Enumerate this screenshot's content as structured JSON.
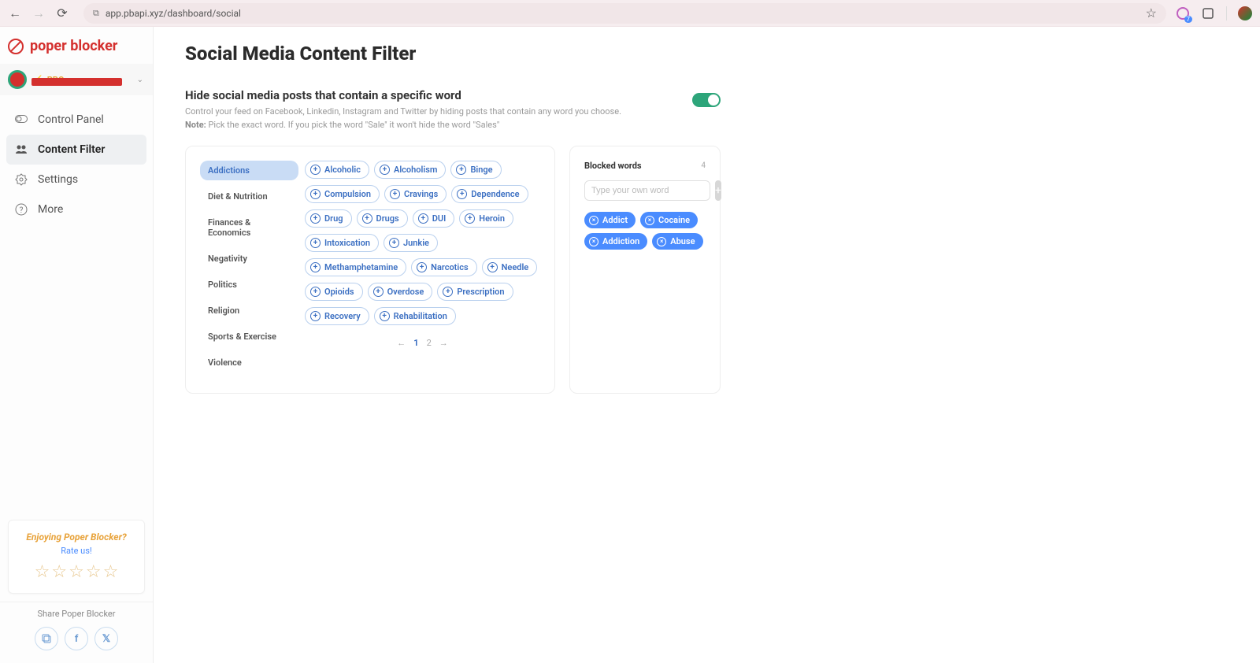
{
  "browser": {
    "url": "app.pbapi.xyz/dashboard/social",
    "ext_badge": "7"
  },
  "brand": {
    "name": "poper blocker"
  },
  "account": {
    "badge": "PRO"
  },
  "sidebar": {
    "items": [
      {
        "label": "Control Panel"
      },
      {
        "label": "Content Filter"
      },
      {
        "label": "Settings"
      },
      {
        "label": "More"
      }
    ]
  },
  "rate": {
    "title": "Enjoying Poper Blocker?",
    "link": "Rate us!"
  },
  "share": {
    "label": "Share Poper Blocker"
  },
  "page": {
    "title": "Social Media Content Filter"
  },
  "hero": {
    "title": "Hide social media posts that contain a specific word",
    "sub": "Control your feed on Facebook, Linkedin, Instagram and Twitter by hiding posts that contain any word you choose.",
    "note_label": "Note:",
    "note_text": "Pick the exact word. If you pick the word \"Sale\" it won't hide the word \"Sales\""
  },
  "categories": [
    "Addictions",
    "Diet & Nutrition",
    "Finances & Economics",
    "Negativity",
    "Politics",
    "Religion",
    "Sports & Exercise",
    "Violence"
  ],
  "suggested_words": [
    "Alcoholic",
    "Alcoholism",
    "Binge",
    "Compulsion",
    "Cravings",
    "Dependence",
    "Drug",
    "Drugs",
    "DUI",
    "Heroin",
    "Intoxication",
    "Junkie",
    "Methamphetamine",
    "Narcotics",
    "Needle",
    "Opioids",
    "Overdose",
    "Prescription",
    "Recovery",
    "Rehabilitation"
  ],
  "pager": {
    "current": "1",
    "other": "2"
  },
  "blocked": {
    "title": "Blocked words",
    "count": "4",
    "placeholder": "Type your own word",
    "words": [
      "Addict",
      "Cocaine",
      "Addiction",
      "Abuse"
    ]
  }
}
